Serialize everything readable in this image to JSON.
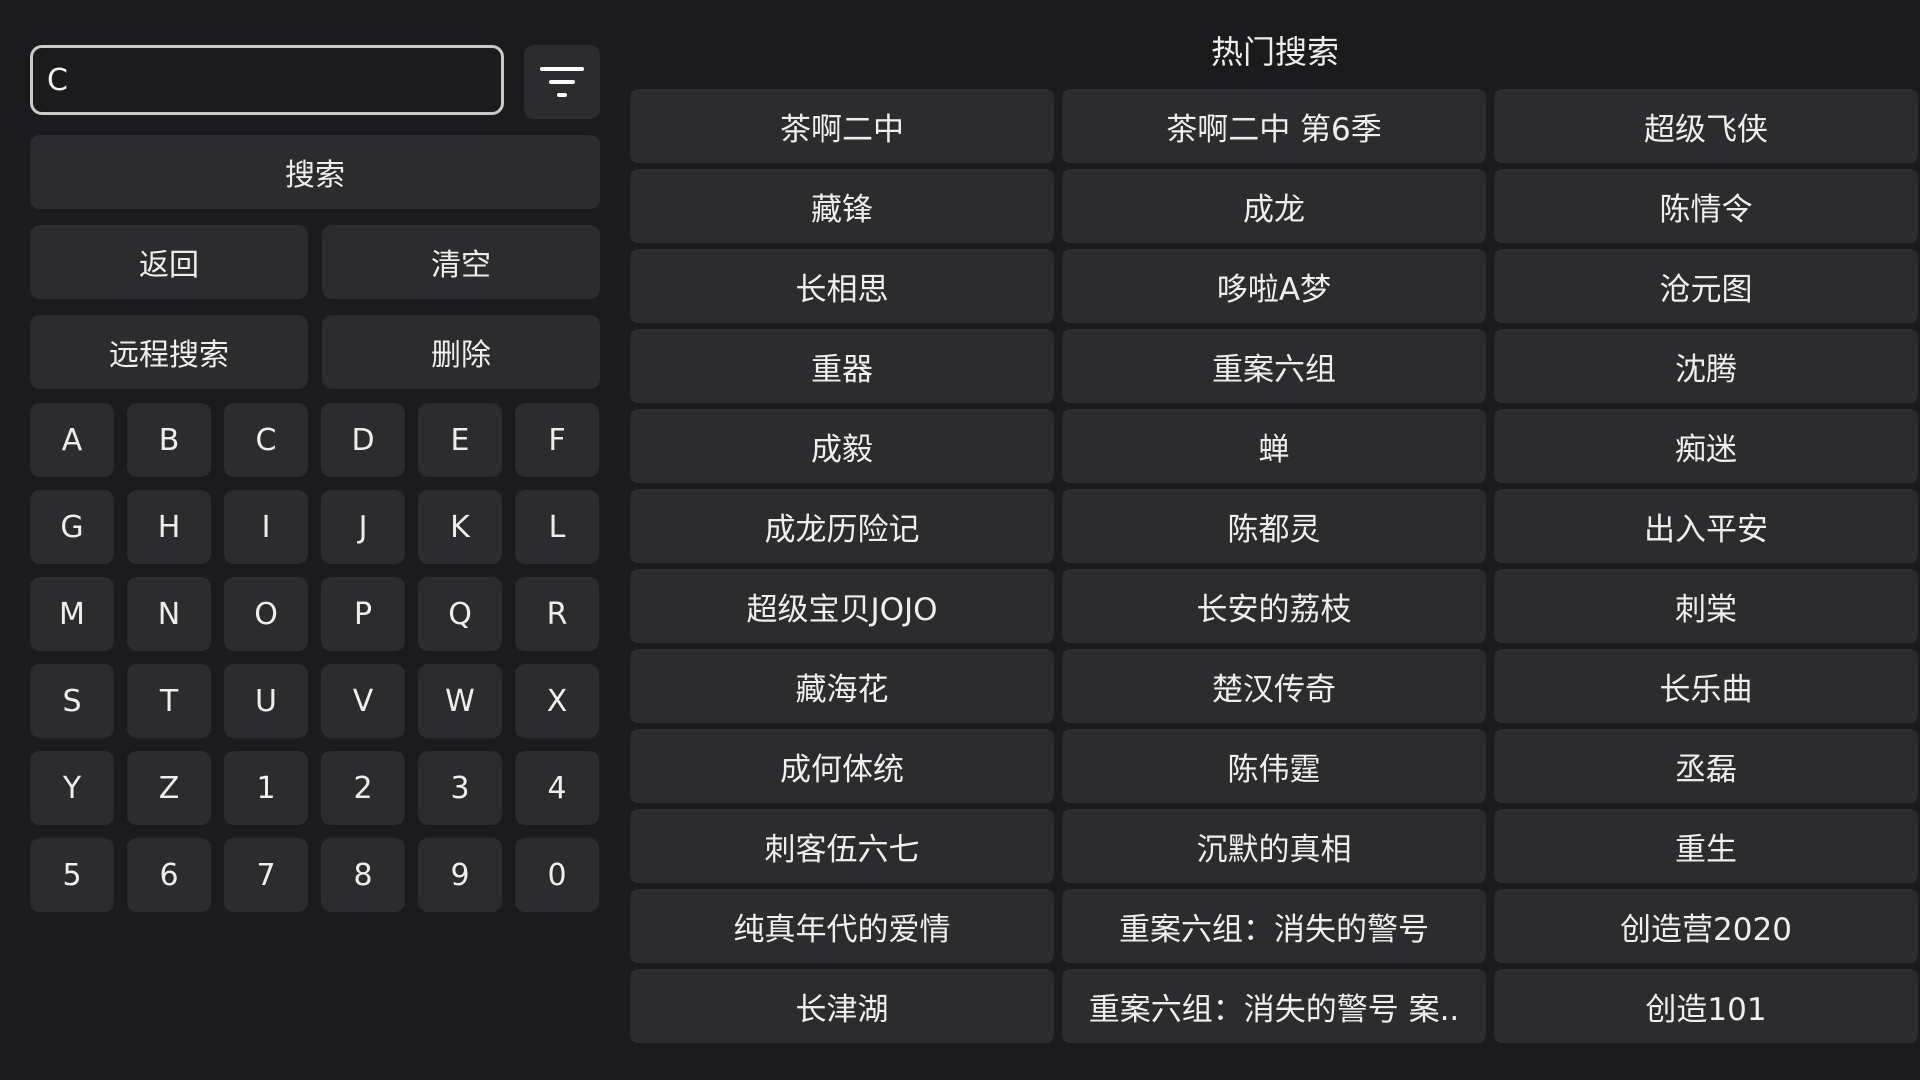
{
  "search": {
    "value": "C"
  },
  "actions": {
    "search": "搜索",
    "back": "返回",
    "clear": "清空",
    "remote_search": "远程搜索",
    "delete": "删除"
  },
  "keys": [
    "A",
    "B",
    "C",
    "D",
    "E",
    "F",
    "G",
    "H",
    "I",
    "J",
    "K",
    "L",
    "M",
    "N",
    "O",
    "P",
    "Q",
    "R",
    "S",
    "T",
    "U",
    "V",
    "W",
    "X",
    "Y",
    "Z",
    "1",
    "2",
    "3",
    "4",
    "5",
    "6",
    "7",
    "8",
    "9",
    "0"
  ],
  "hot": {
    "title": "热门搜索",
    "items": [
      "茶啊二中",
      "茶啊二中 第6季",
      "超级飞侠",
      "藏锋",
      "成龙",
      "陈情令",
      "长相思",
      "哆啦A梦",
      "沧元图",
      "重器",
      "重案六组",
      "沈腾",
      "成毅",
      "蝉",
      "痴迷",
      "成龙历险记",
      "陈都灵",
      "出入平安",
      "超级宝贝JOJO",
      "长安的荔枝",
      "刺棠",
      "藏海花",
      "楚汉传奇",
      "长乐曲",
      "成何体统",
      "陈伟霆",
      "丞磊",
      "刺客伍六七",
      "沉默的真相",
      "重生",
      "纯真年代的爱情",
      "重案六组：消失的警号",
      "创造营2020",
      "长津湖",
      "重案六组：消失的警号 案..",
      "创造101"
    ]
  },
  "icons": {
    "filter": "filter-icon"
  }
}
